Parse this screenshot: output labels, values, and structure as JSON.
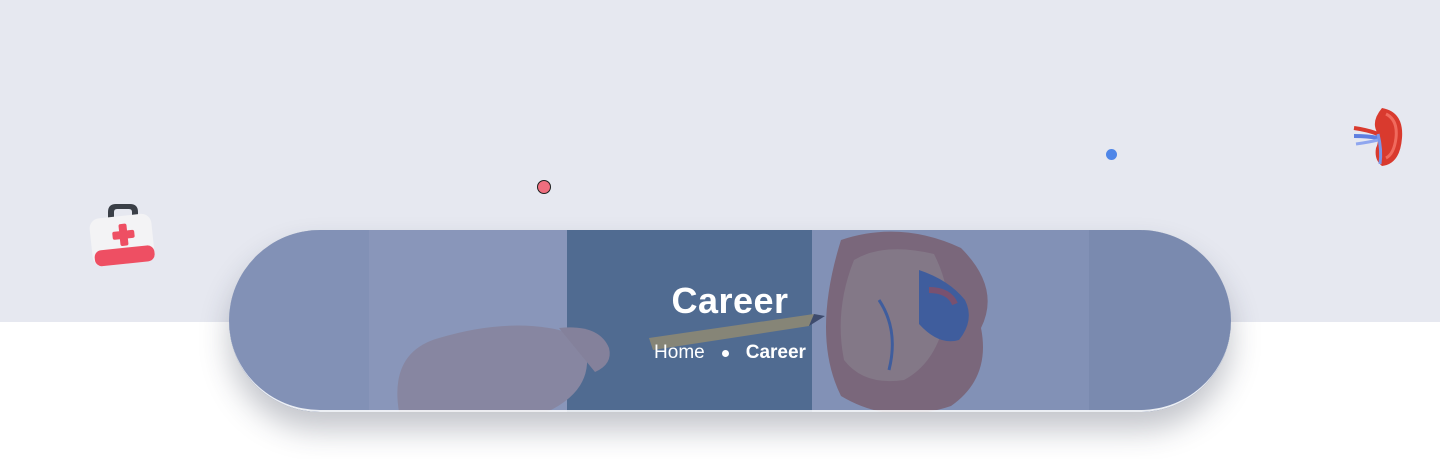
{
  "page": {
    "title": "Career"
  },
  "breadcrumb": {
    "home_label": "Home",
    "current_label": "Career"
  },
  "decor": {
    "icons": [
      "medical-kit-icon",
      "kidney-icon"
    ],
    "dot_colors": [
      "#ef6e7e",
      "#4f86e8"
    ]
  },
  "colors": {
    "band_background": "#e6e8f0",
    "banner_overlay": "#4a6096"
  }
}
